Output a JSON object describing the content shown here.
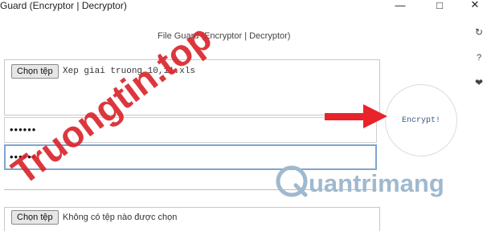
{
  "window": {
    "title": "Guard (Encryptor | Decryptor)",
    "minimize_glyph": "—",
    "maximize_glyph": "□",
    "close_glyph": "✕"
  },
  "app": {
    "title": "File Guard (Encryptor | Decryptor)"
  },
  "side_icons": [
    {
      "name": "refresh-icon",
      "glyph": "↻"
    },
    {
      "name": "help-icon",
      "glyph": "?"
    },
    {
      "name": "heart-icon",
      "glyph": "❤"
    }
  ],
  "file_input": {
    "button_label": "Chọn tệp",
    "file_name": "Xep giai truong 10,11.xls"
  },
  "password_1": {
    "masked": "••••••"
  },
  "password_2": {
    "masked": "••••••"
  },
  "encrypt": {
    "label": "Encrypt!"
  },
  "file_input_2": {
    "button_label": "Chọn tệp",
    "file_name": "Không có tệp nào được chọn"
  },
  "watermarks": [
    {
      "name": "truongtin-watermark",
      "text": "Truongtin.top",
      "color": "#d9262c"
    },
    {
      "name": "quantrimang-watermark",
      "text": "uantrimang",
      "color": "#9fb9cf"
    }
  ],
  "colors": {
    "arrow": "#e8232a",
    "focus_border": "#7da6cf",
    "encrypt_text": "#3c5a86"
  }
}
